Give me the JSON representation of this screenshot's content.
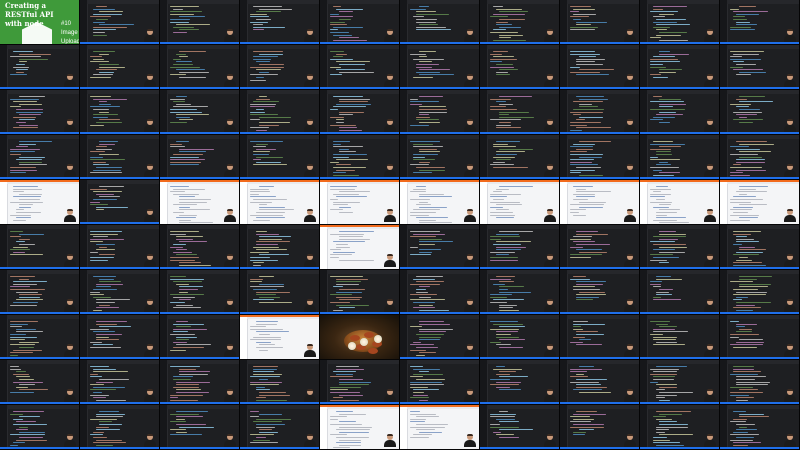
{
  "title_card": {
    "course": "Creating a\nRESTful API\nwith node",
    "episode": "#10\nImage\nUpload"
  },
  "contact_sheet": {
    "rows": 10,
    "cols": 10,
    "tile_kinds": [
      [
        "title",
        "editor",
        "editor",
        "editor",
        "editor",
        "editor",
        "editor",
        "editor",
        "editor",
        "editor"
      ],
      [
        "editor",
        "editor",
        "editor",
        "editor",
        "editor",
        "editor",
        "editor",
        "editor",
        "editor",
        "editor"
      ],
      [
        "editor",
        "editor",
        "editor",
        "editor",
        "editor",
        "editor",
        "editor",
        "editor",
        "editor",
        "editor"
      ],
      [
        "editor",
        "editor",
        "editor",
        "editor",
        "editor",
        "editor",
        "editor",
        "editor",
        "editor",
        "editor"
      ],
      [
        "browser",
        "editor",
        "browser",
        "browser",
        "browser",
        "browser",
        "browser",
        "browser",
        "browser",
        "browser"
      ],
      [
        "editor",
        "editor",
        "editor",
        "editor",
        "browser",
        "editor",
        "editor",
        "editor",
        "editor",
        "editor"
      ],
      [
        "editor",
        "editor",
        "editor",
        "editor",
        "editor",
        "editor",
        "editor",
        "editor",
        "editor",
        "editor"
      ],
      [
        "editor",
        "editor",
        "editor",
        "browser",
        "photo",
        "editor",
        "editor",
        "editor",
        "editor",
        "editor"
      ],
      [
        "editor",
        "editor",
        "editor",
        "editor",
        "editor",
        "editor",
        "editor",
        "editor",
        "editor",
        "editor"
      ],
      [
        "editor",
        "editor",
        "editor",
        "editor",
        "browser",
        "browser",
        "editor",
        "editor",
        "editor",
        "editor"
      ]
    ],
    "colors": {
      "editor_bg": "#1e1f22",
      "keyword": "#569cd6",
      "string": "#ce9178",
      "function": "#dcdcaa",
      "comment": "#6a9955",
      "variable": "#9cdcfe",
      "accent_status": "#1f6feb",
      "browser_accent": "#f26b1d",
      "title_green": "#3f9a3a"
    }
  }
}
